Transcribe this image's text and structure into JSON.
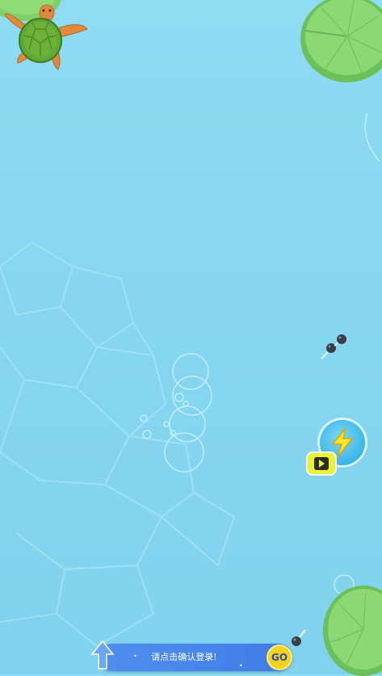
{
  "game": {
    "player": "sea-turtle",
    "enemies": [
      "tadpole",
      "tadpole",
      "tadpole"
    ]
  },
  "buttons": {
    "boost_icon": "lightning-icon",
    "video_icon": "play-icon"
  },
  "login_bar": {
    "text": "请点击确认登录!",
    "badge": "GO"
  },
  "colors": {
    "water": "#86d6f0",
    "lily_pad": "#7fcf6a",
    "turtle_shell": "#6cb23a",
    "turtle_skin": "#e08a3c",
    "boost_button": "#3ab6ea",
    "video_button": "#e8f52e",
    "login_bar": "#3f7de6"
  }
}
